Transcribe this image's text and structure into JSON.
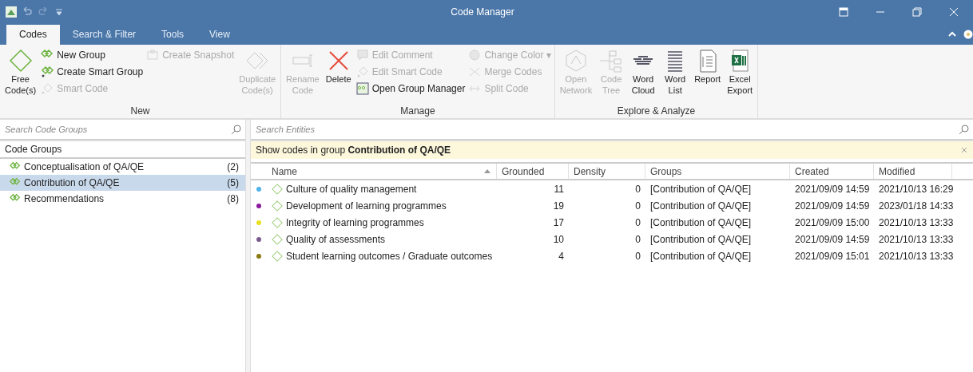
{
  "window": {
    "title": "Code Manager"
  },
  "ribbon_tabs": [
    {
      "label": "Codes",
      "selected": true
    },
    {
      "label": "Search & Filter",
      "selected": false
    },
    {
      "label": "Tools",
      "selected": false
    },
    {
      "label": "View",
      "selected": false
    }
  ],
  "ribbon_groups": [
    {
      "label": "New",
      "items": [
        {
          "kind": "large",
          "label": "Free\nCode(s)",
          "disabled": false
        },
        {
          "kind": "stack",
          "buttons": [
            {
              "label": "New Group",
              "disabled": false
            },
            {
              "label": "Create Smart Group",
              "disabled": false
            },
            {
              "label": "Smart Code",
              "disabled": true
            }
          ]
        },
        {
          "kind": "stack",
          "buttons": [
            {
              "label": "Create Snapshot",
              "disabled": true
            }
          ]
        },
        {
          "kind": "large",
          "label": "Duplicate\nCode(s)",
          "disabled": true
        }
      ]
    },
    {
      "label": "Manage",
      "items": [
        {
          "kind": "large",
          "label": "Rename\nCode",
          "disabled": true
        },
        {
          "kind": "large",
          "label": "Delete",
          "disabled": false
        },
        {
          "kind": "stack",
          "buttons": [
            {
              "label": "Edit Comment",
              "disabled": true
            },
            {
              "label": "Edit Smart Code",
              "disabled": true
            },
            {
              "label": "Open Group Manager",
              "disabled": false
            }
          ]
        },
        {
          "kind": "stack",
          "buttons": [
            {
              "label": "Change Color ▾",
              "disabled": true
            },
            {
              "label": "Merge Codes",
              "disabled": true
            },
            {
              "label": "Split Code",
              "disabled": true
            }
          ]
        }
      ]
    },
    {
      "label": "Explore & Analyze",
      "items": [
        {
          "kind": "large",
          "label": "Open\nNetwork",
          "disabled": true
        },
        {
          "kind": "large",
          "label": "Code\nTree",
          "disabled": true
        },
        {
          "kind": "large",
          "label": "Word\nCloud",
          "disabled": false
        },
        {
          "kind": "large",
          "label": "Word\nList",
          "disabled": false
        },
        {
          "kind": "large",
          "label": "Report",
          "disabled": false
        },
        {
          "kind": "large",
          "label": "Excel\nExport",
          "disabled": false
        }
      ]
    }
  ],
  "groups_pane": {
    "search": {
      "placeholder": "Search Code Groups"
    },
    "header": "Code Groups",
    "items": [
      {
        "label": "Conceptualisation of QA/QE",
        "count": "(2)",
        "selected": false
      },
      {
        "label": "Contribution of QA/QE",
        "count": "(5)",
        "selected": true
      },
      {
        "label": "Recommendations",
        "count": "(8)",
        "selected": false
      }
    ]
  },
  "codes_pane": {
    "search": {
      "placeholder": "Search Entities"
    },
    "filter": "Show codes in group **Contribution of QA/QE**",
    "table": {
      "columns": [
        {
          "label": "Name",
          "sorted": true
        },
        {
          "label": "Grounded",
          "sorted": false
        },
        {
          "label": "Density",
          "sorted": false
        },
        {
          "label": "Groups",
          "sorted": false
        },
        {
          "label": "Created",
          "sorted": false
        },
        {
          "label": "Modified",
          "sorted": false
        }
      ],
      "rows": [
        {
          "color": "#4fb3e8",
          "name": "Culture of quality management",
          "grounded": "11",
          "density": "0",
          "groups": "[Contribution of QA/QE]",
          "created": "2021/09/09 14:59",
          "modified": "2021/10/13 16:29"
        },
        {
          "color": "#8a1a9b",
          "name": "Development of learning programmes",
          "grounded": "19",
          "density": "0",
          "groups": "[Contribution of QA/QE]",
          "created": "2021/09/09 14:59",
          "modified": "2023/01/18 14:33"
        },
        {
          "color": "#e8e020",
          "name": "Integrity of learning programmes",
          "grounded": "17",
          "density": "0",
          "groups": "[Contribution of QA/QE]",
          "created": "2021/09/09 15:00",
          "modified": "2021/10/13 13:33"
        },
        {
          "color": "#7a5a8c",
          "name": "Quality of assessments",
          "grounded": "10",
          "density": "0",
          "groups": "[Contribution of QA/QE]",
          "created": "2021/09/09 14:59",
          "modified": "2021/10/13 13:33"
        },
        {
          "color": "#8a7a10",
          "name": "Student learning outcomes / Graduate outcomes",
          "grounded": "4",
          "density": "0",
          "groups": "[Contribution of QA/QE]",
          "created": "2021/09/09 15:01",
          "modified": "2021/10/13 13:33"
        }
      ]
    }
  }
}
